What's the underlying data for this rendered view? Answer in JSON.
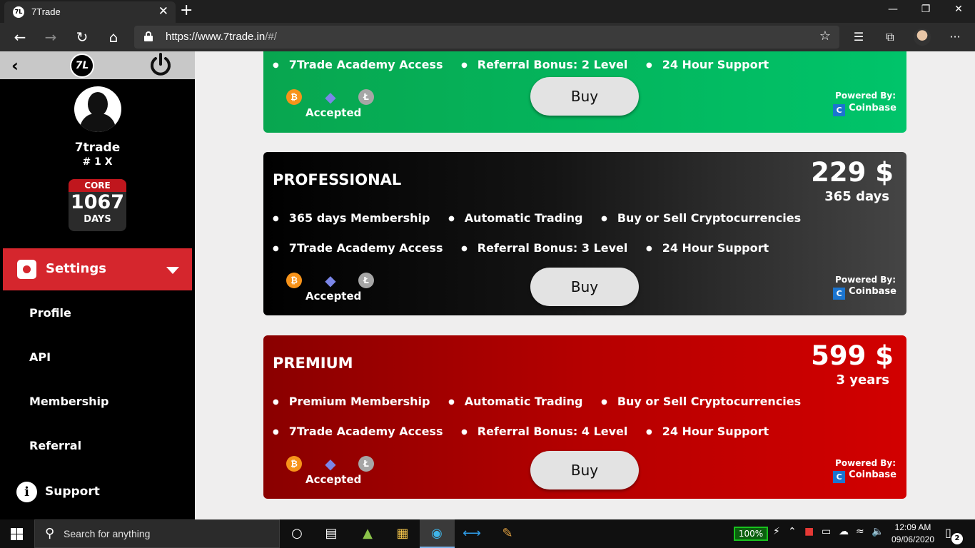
{
  "browser": {
    "tab_title": "7Trade",
    "tab_favicon": "7L",
    "url_host": "https://www.7trade.in",
    "url_rest": "/#/",
    "new_tab": "+",
    "icons": {
      "back": "←",
      "forward": "→",
      "refresh": "↻",
      "home": "⌂",
      "star": "☆",
      "favorites": "☰",
      "collections": "⧉",
      "more": "···"
    },
    "window": {
      "minimize": "—",
      "restore": "❐",
      "close": "✕"
    }
  },
  "sidebar": {
    "back": "‹",
    "logo": "7L",
    "username": "7trade",
    "rank": "# 1 X",
    "badge": {
      "label": "CORE",
      "value": "1067",
      "unit": "DAYS"
    },
    "settings_label": "Settings",
    "items": [
      {
        "label": "Profile"
      },
      {
        "label": "API"
      },
      {
        "label": "Membership"
      },
      {
        "label": "Referral"
      }
    ],
    "support_icon": "i",
    "support_label": "Support"
  },
  "plans": [
    {
      "name": "",
      "price": "",
      "duration": "",
      "features_row1": [],
      "features_row2": [
        "7Trade Academy Access",
        "Referral Bonus: 2 Level",
        "24 Hour Support"
      ],
      "accepted": "Accepted",
      "buy": "Buy",
      "powered_by": "Powered By:",
      "provider": "Coinbase",
      "color": "#00b860"
    },
    {
      "name": "PROFESSIONAL",
      "price": "229 $",
      "duration": "365 days",
      "features_row1": [
        "365 days Membership",
        "Automatic Trading",
        "Buy or Sell Cryptocurrencies"
      ],
      "features_row2": [
        "7Trade Academy Access",
        "Referral Bonus: 3 Level",
        "24 Hour Support"
      ],
      "accepted": "Accepted",
      "buy": "Buy",
      "powered_by": "Powered By:",
      "provider": "Coinbase",
      "color": "#1a1a1a"
    },
    {
      "name": "PREMIUM",
      "price": "599 $",
      "duration": "3 years",
      "features_row1": [
        "Premium Membership",
        "Automatic Trading",
        "Buy or Sell Cryptocurrencies"
      ],
      "features_row2": [
        "7Trade Academy Access",
        "Referral Bonus: 4 Level",
        "24 Hour Support"
      ],
      "accepted": "Accepted",
      "buy": "Buy",
      "powered_by": "Powered By:",
      "provider": "Coinbase",
      "color": "#c00000"
    }
  ],
  "coin_glyphs": {
    "btc": "₿",
    "eth": "◆",
    "ltc": "Ł",
    "coinbase": "C"
  },
  "taskbar": {
    "search_placeholder": "Search for anything",
    "battery": "100%",
    "time": "12:09 AM",
    "date": "09/06/2020",
    "notifications": "2"
  }
}
